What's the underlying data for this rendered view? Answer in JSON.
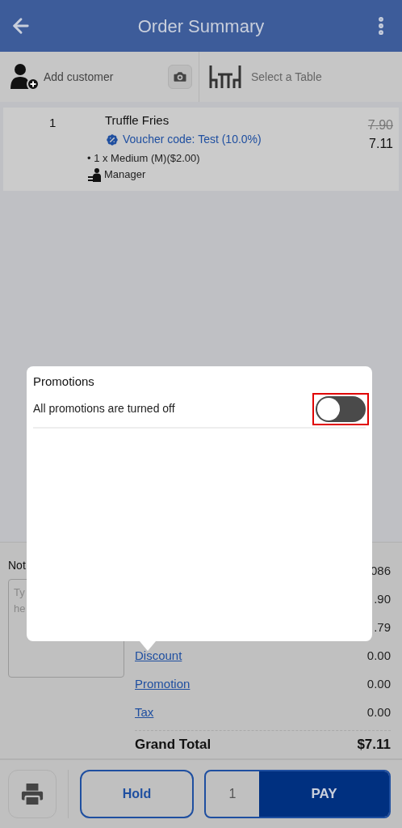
{
  "header": {
    "title": "Order Summary"
  },
  "customer_bar": {
    "customer": "Add customer",
    "table": "Select a Table"
  },
  "items": [
    {
      "qty": "1",
      "name": "Truffle Fries",
      "voucher": "Voucher code: Test (10.0%)",
      "modifier": "• 1 x Medium (M)($2.00)",
      "staff": "Manager",
      "old_price": "7.90",
      "price": "7.11"
    }
  ],
  "notes": {
    "label": "Not",
    "placeholder": "Ty\nhe"
  },
  "summary_rows": [
    {
      "kind": "plain",
      "value": "086"
    },
    {
      "kind": "plain",
      "value": ".90"
    },
    {
      "kind": "plain",
      "value": ".79"
    },
    {
      "kind": "link",
      "label": "Discount",
      "value": "0.00"
    },
    {
      "kind": "link",
      "label": "Promotion",
      "value": "0.00"
    },
    {
      "kind": "link",
      "label": "Tax",
      "value": "0.00"
    }
  ],
  "grand_total": {
    "label": "Grand Total",
    "value": "$7.11"
  },
  "footer": {
    "hold": "Hold",
    "quantity": "1",
    "pay": "PAY"
  },
  "popover": {
    "title": "Promotions",
    "setting": "All promotions are turned off",
    "on": false,
    "annotation": {
      "kind": "box",
      "color": "#e00000"
    }
  }
}
